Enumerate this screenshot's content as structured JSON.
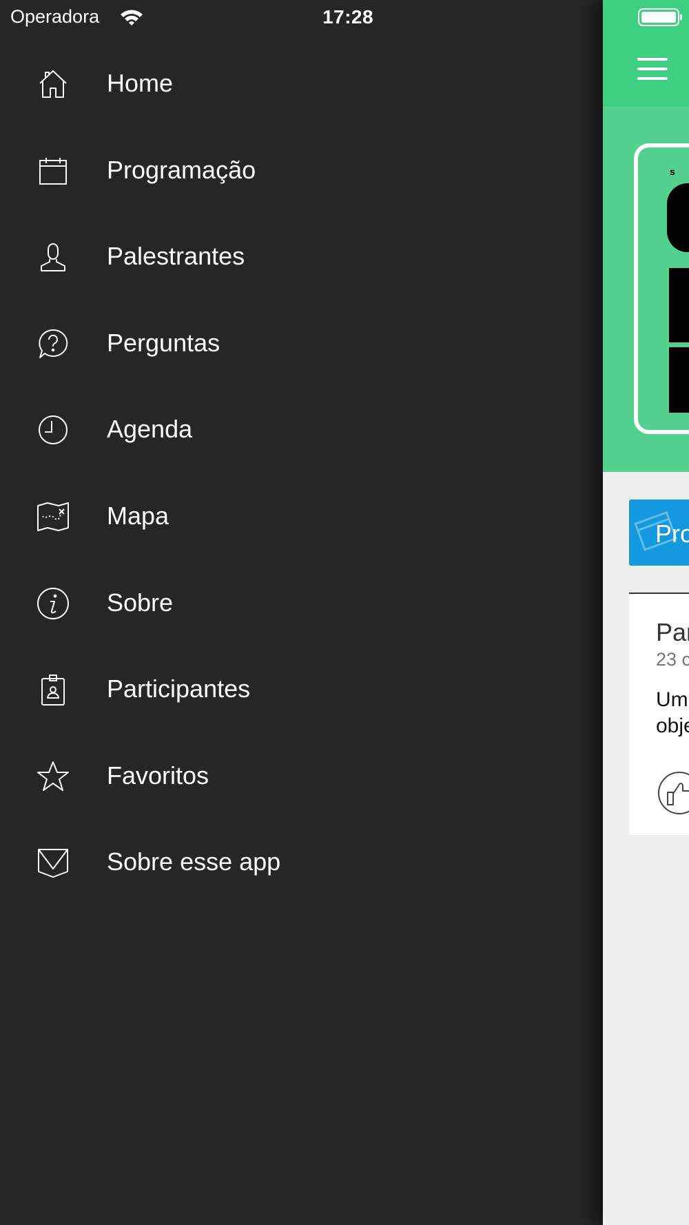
{
  "status_bar": {
    "carrier": "Operadora",
    "time": "17:28"
  },
  "menu": {
    "items": [
      {
        "label": "Home",
        "icon": "home-icon"
      },
      {
        "label": "Programação",
        "icon": "calendar-icon"
      },
      {
        "label": "Palestrantes",
        "icon": "person-icon"
      },
      {
        "label": "Perguntas",
        "icon": "question-icon"
      },
      {
        "label": "Agenda",
        "icon": "clock-icon"
      },
      {
        "label": "Mapa",
        "icon": "map-icon"
      },
      {
        "label": "Sobre",
        "icon": "info-icon"
      },
      {
        "label": "Participantes",
        "icon": "badge-icon"
      },
      {
        "label": "Favoritos",
        "icon": "star-icon"
      },
      {
        "label": "Sobre esse app",
        "icon": "envelope-icon"
      }
    ]
  },
  "main": {
    "program_button_label": "Pro",
    "card": {
      "title": "Par",
      "date": "23 c",
      "body": "Um\nobje"
    }
  },
  "colors": {
    "menu_background": "#262626",
    "header_green": "#3fcf82",
    "banner_green": "#54d18f",
    "program_blue": "#1499de"
  }
}
